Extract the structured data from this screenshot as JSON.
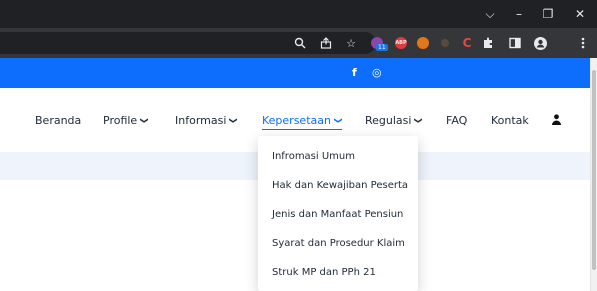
{
  "browser": {
    "window_controls": {
      "dropdown": "⌵",
      "minimize": "–",
      "restore": "❐",
      "close": "✕"
    },
    "toolbar_icons": [
      "search-icon",
      "share-icon",
      "star-icon",
      "extension-icon",
      "abp-icon",
      "fox-icon",
      "fox-icon",
      "extension-icon",
      "puzzle-icon",
      "sidebar-icon",
      "profile-icon",
      "menu-icon"
    ],
    "extension_badge": "11",
    "abp_label": "ABP"
  },
  "topbar": {
    "color": "#0d6efd",
    "social": [
      "f",
      "◎"
    ]
  },
  "nav": {
    "items": [
      {
        "label": "Beranda",
        "caret": false
      },
      {
        "label": "Profile",
        "caret": true
      },
      {
        "label": "Informasi",
        "caret": true
      },
      {
        "label": "Kepersetaan",
        "caret": true,
        "active": true
      },
      {
        "label": "Regulasi",
        "caret": true
      },
      {
        "label": "FAQ",
        "caret": false
      },
      {
        "label": "Kontak",
        "caret": false
      }
    ],
    "caret_glyph": "❯"
  },
  "dropdown": {
    "items": [
      "Infromasi Umum",
      "Hak dan Kewajiban Peserta",
      "Jenis dan Manfaat Pensiun",
      "Syarat dan Prosedur Klaim",
      "Struk MP dan PPh 21"
    ]
  }
}
